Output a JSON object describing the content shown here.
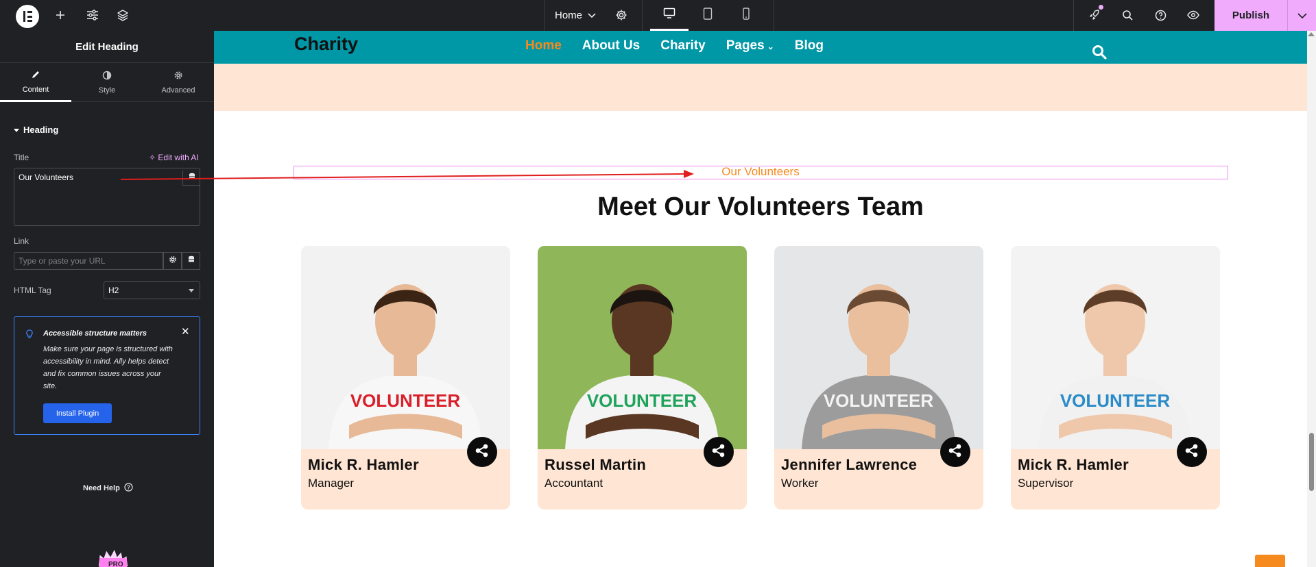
{
  "topbar": {
    "page_name": "Home",
    "publish_label": "Publish",
    "icons": [
      "elementor-logo-icon",
      "plus-icon",
      "sliders-icon",
      "layers-icon",
      "chevron-down-icon",
      "gear-icon",
      "desktop-icon",
      "tablet-icon",
      "mobile-icon",
      "rocket-icon",
      "search-icon",
      "help-icon",
      "eye-icon"
    ]
  },
  "panel": {
    "title": "Edit Heading",
    "tabs": [
      {
        "label": "Content",
        "icon": "pencil-icon",
        "active": true
      },
      {
        "label": "Style",
        "icon": "half-circle-icon",
        "active": false
      },
      {
        "label": "Advanced",
        "icon": "gear-icon",
        "active": false
      }
    ],
    "section": "Heading",
    "title_label": "Title",
    "edit_with_ai": "Edit with AI",
    "title_value": "Our Volunteers",
    "link_label": "Link",
    "link_placeholder": "Type or paste your URL",
    "html_tag_label": "HTML Tag",
    "html_tag_value": "H2",
    "notice": {
      "title": "Accessible structure matters",
      "body": "Make sure your page is structured with accessibility in mind. Ally helps detect and fix common issues across your site.",
      "button": "Install Plugin"
    },
    "need_help": "Need Help"
  },
  "site": {
    "brand": "Charity",
    "nav": [
      "Home",
      "About Us",
      "Charity",
      "Pages",
      "Blog"
    ],
    "subtitle": "Our Volunteers",
    "heading": "Meet Our Volunteers Team",
    "team": [
      {
        "name": "Mick R. Hamler",
        "role": "Manager",
        "shirt_text": "VOLUNTEER",
        "shirt_text_color": "#d81f2a",
        "bg": "#f2f2f2",
        "skin": "#e7b996",
        "hair": "#3b2414",
        "shirt": "#f7f7f7"
      },
      {
        "name": "Russel Martin",
        "role": "Accountant",
        "shirt_text": "VOLUNTEER",
        "shirt_text_color": "#1fa35a",
        "bg": "#8fb75a",
        "skin": "#5a3722",
        "hair": "#1b1410",
        "shirt": "#f4f4f4"
      },
      {
        "name": "Jennifer Lawrence",
        "role": "Worker",
        "shirt_text": "VOLUNTEER",
        "shirt_text_color": "#f4f4f4",
        "bg": "#e4e6e8",
        "skin": "#e9bf9e",
        "hair": "#6b4a33",
        "shirt": "#9c9c9c"
      },
      {
        "name": "Mick R. Hamler",
        "role": "Supervisor",
        "shirt_text": "VOLUNTEER",
        "shirt_text_color": "#2a8bc7",
        "bg": "#f3f3f3",
        "skin": "#efc8ab",
        "hair": "#5d3d27",
        "shirt": "#f1f1f1"
      }
    ]
  },
  "colors": {
    "editor_dark": "#1f2124",
    "publish": "#f0abfc",
    "site_header": "#0097a7",
    "accent_orange": "#f68a1f",
    "card_bg": "#ffe5d3"
  }
}
